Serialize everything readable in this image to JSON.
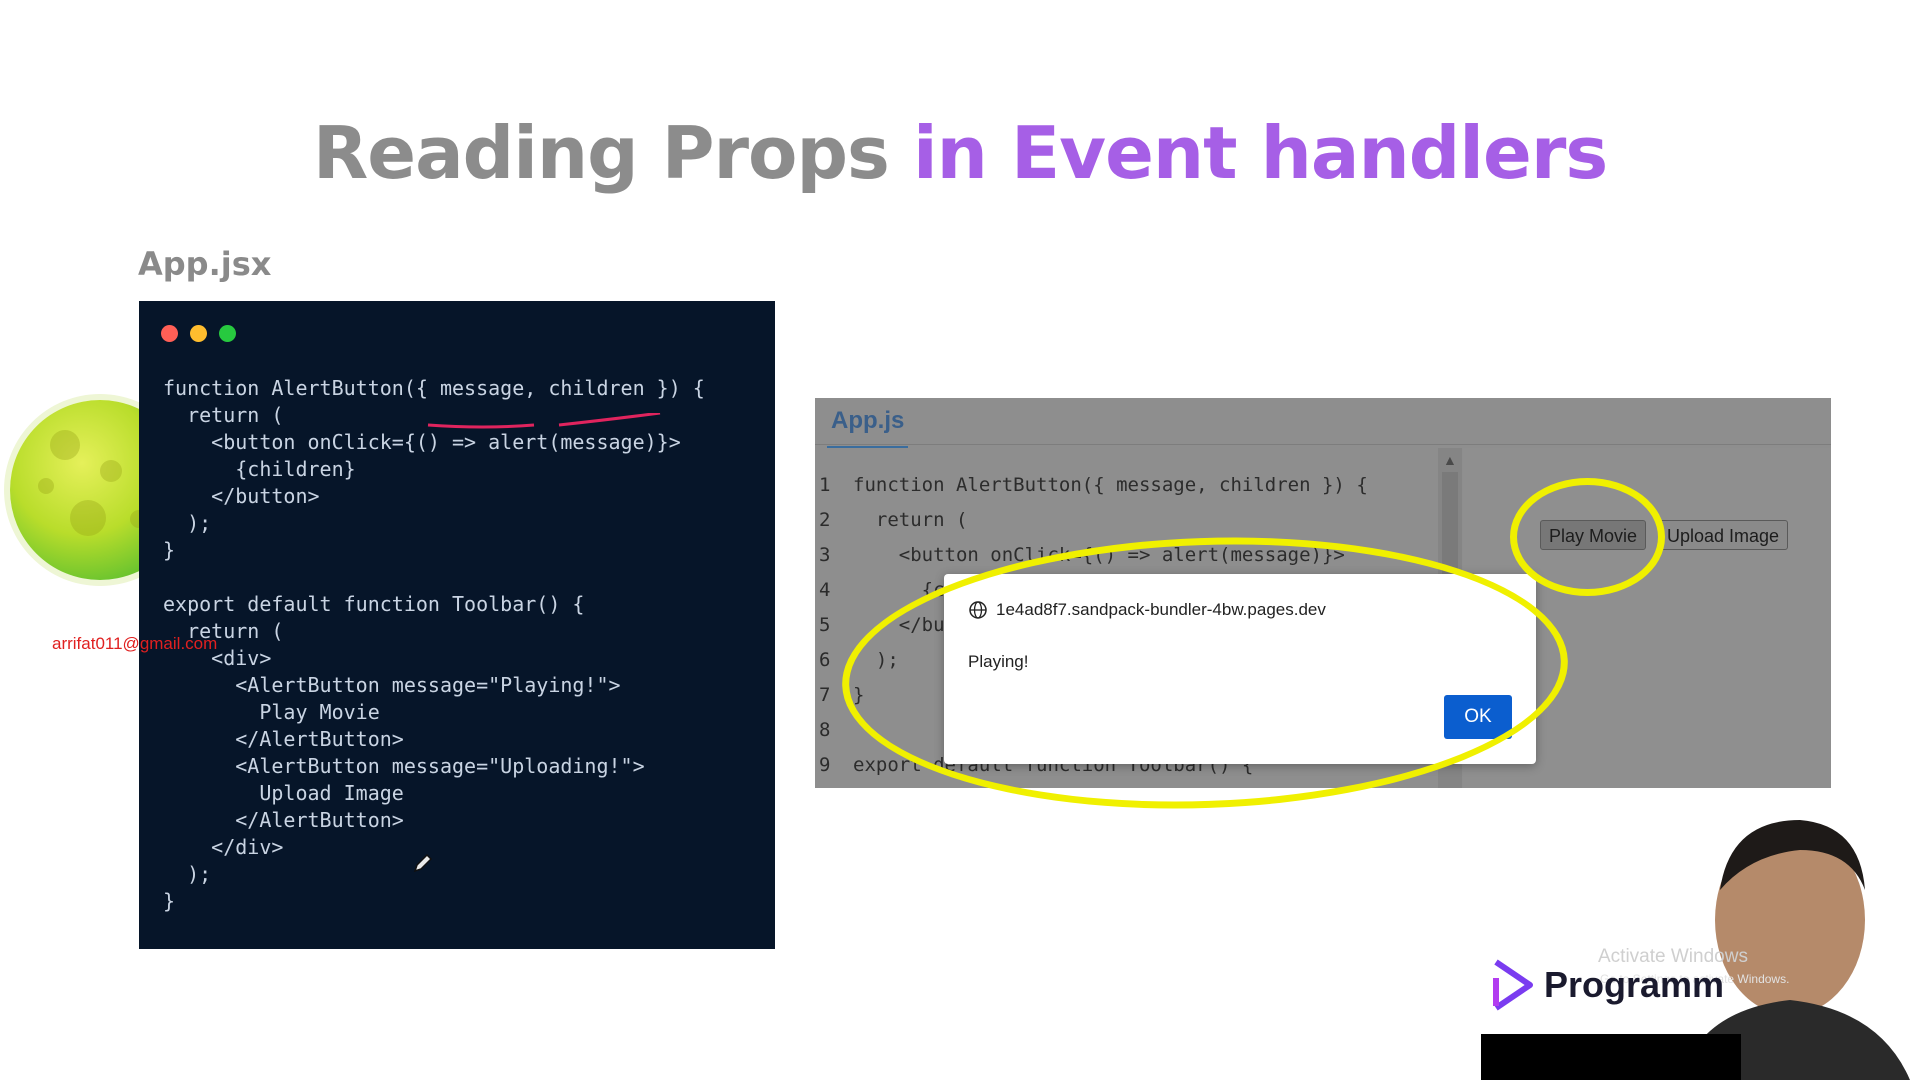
{
  "slide": {
    "title_part1": "Reading Props",
    "title_part2": "in Event handlers",
    "file_label": "App.jsx",
    "watermark_email": "arrifat011@gmail.com"
  },
  "code_editor": {
    "lines": [
      "function AlertButton({ message, children }) {",
      "  return (",
      "    <button onClick={() => alert(message)}>",
      "      {children}",
      "    </button>",
      "  );",
      "}",
      "",
      "export default function Toolbar() {",
      "  return (",
      "    <div>",
      "      <AlertButton message=\"Playing!\">",
      "        Play Movie",
      "      </AlertButton>",
      "      <AlertButton message=\"Uploading!\">",
      "        Upload Image",
      "      </AlertButton>",
      "    </div>",
      "  );",
      "}"
    ]
  },
  "sandbox": {
    "tab_label": "App.js",
    "lines": [
      {
        "num": "1",
        "text": "function AlertButton({ message, children }) {"
      },
      {
        "num": "2",
        "text": "  return ("
      },
      {
        "num": "3",
        "text": "    <button onClick={() => alert(message)}>"
      },
      {
        "num": "4",
        "text": "      {c"
      },
      {
        "num": "5",
        "text": "    </bu"
      },
      {
        "num": "6",
        "text": "  );"
      },
      {
        "num": "7",
        "text": "}"
      },
      {
        "num": "8",
        "text": ""
      },
      {
        "num": "9",
        "text": "export default function Toolbar() {"
      }
    ],
    "preview_buttons": [
      "Play Movie",
      "Upload Image"
    ]
  },
  "alert_dialog": {
    "origin": "1e4ad8f7.sandpack-bundler-4bw.pages.dev",
    "message": "Playing!",
    "ok_label": "OK"
  },
  "overlay": {
    "activate_windows": "Activate Windows",
    "activate_sub": "Go to Settings to activate Windows.",
    "brand": "Programm"
  },
  "colors": {
    "title_gray": "#8c8c8c",
    "title_purple": "#a65fe6",
    "editor_bg": "#061529",
    "highlight_ring": "#f0f000",
    "ok_button": "#0b5ecf"
  }
}
